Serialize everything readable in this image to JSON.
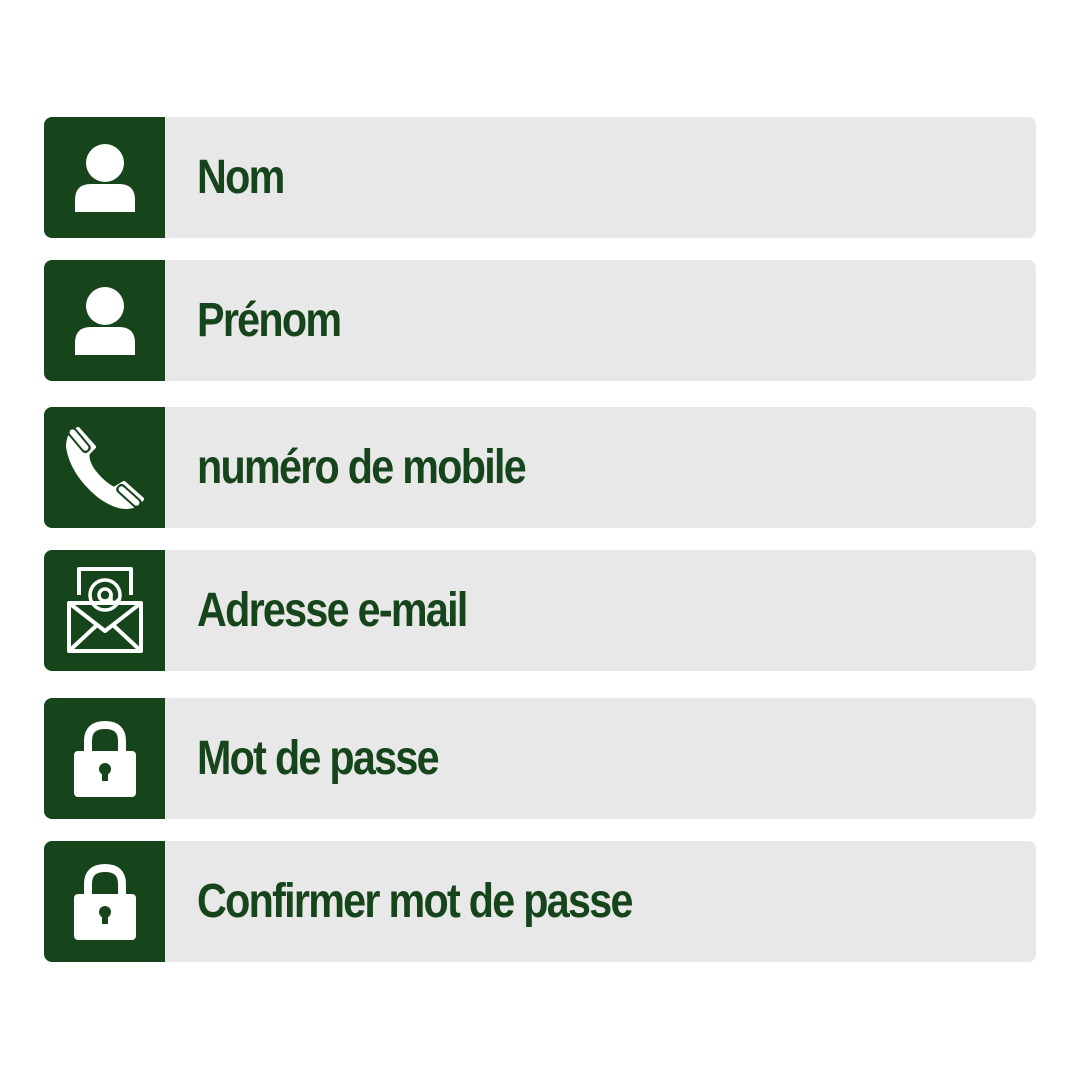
{
  "theme": {
    "accent": "#17451b",
    "field_background": "#e8e8e8",
    "icon_color": "#ffffff"
  },
  "form": {
    "fields": [
      {
        "placeholder": "Nom",
        "icon": "user-icon"
      },
      {
        "placeholder": "Prénom",
        "icon": "user-icon"
      },
      {
        "placeholder": "numéro de mobile",
        "icon": "phone-icon"
      },
      {
        "placeholder": "Adresse e-mail",
        "icon": "email-icon"
      },
      {
        "placeholder": "Mot de passe",
        "icon": "lock-icon"
      },
      {
        "placeholder": "Confirmer mot de passe",
        "icon": "lock-icon"
      }
    ]
  }
}
